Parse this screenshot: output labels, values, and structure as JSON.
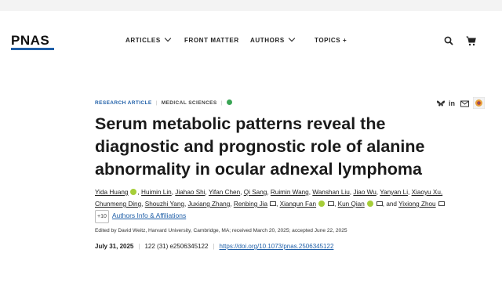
{
  "header": {
    "logo": "PNAS",
    "nav": [
      "ARTICLES",
      "FRONT MATTER",
      "AUTHORS",
      "TOPICS +"
    ],
    "icons": [
      "search-icon",
      "cart-icon"
    ]
  },
  "article": {
    "type": "RESEARCH ARTICLE",
    "section": "MEDICAL SCIENCES",
    "title": "Serum metabolic patterns reveal the diagnostic and prognostic role of alanine abnormality in ocular adnexal lymphoma",
    "share_icons": [
      "bluesky-icon",
      "linkedin-icon",
      "email-icon",
      "altmetric-icon"
    ],
    "authors_line1": [
      "Yida Huang",
      "Huimin Lin",
      "Jiahao Shi",
      "Yifan Chen",
      "Qi Sang",
      "Ruimin Wang",
      "Wanshan Liu",
      "Jiao Wu",
      "Yanyan Li",
      "Xiaoyu Xu,"
    ],
    "authors_line2_a": [
      "Chunmeng Ding",
      "Shouzhi Yang",
      "Juxiang Zhang",
      "Renbing Jia"
    ],
    "authors_line2_b": [
      "Xianqun Fan",
      "Kun Qian"
    ],
    "and_text": ", and",
    "last_author": "Yixiong Zhou",
    "more_count": "+10",
    "info_link": "Authors Info & Affiliations",
    "edited_by": "Edited by David Weitz, Harvard University, Cambridge, MA; received March 20, 2025; accepted June 22, 2025",
    "pub_date": "July 31, 2025",
    "citation": "122 (31) e2506345122",
    "doi": "https://doi.org/10.1073/pnas.2506345122"
  },
  "colors": {
    "brand_blue": "#1f5fa8",
    "orcid_green": "#a6ce39",
    "check_green": "#3aa555"
  }
}
